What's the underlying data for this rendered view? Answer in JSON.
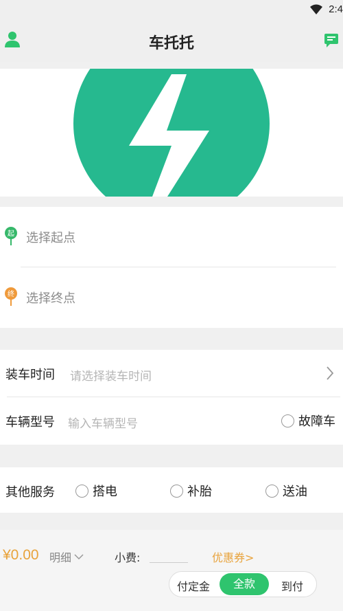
{
  "status_bar": {
    "time": "2:4"
  },
  "header": {
    "title": "车托托"
  },
  "route": {
    "start_placeholder": "选择起点",
    "end_placeholder": "选择终点"
  },
  "loading_time": {
    "label": "装车时间",
    "placeholder": "请选择装车时间"
  },
  "vehicle_model": {
    "label": "车辆型号",
    "placeholder": "输入车辆型号",
    "faulty_label": "故障车"
  },
  "other_services": {
    "label": "其他服务",
    "options": [
      "搭电",
      "补胎",
      "送油"
    ]
  },
  "footer": {
    "price": "¥0.00",
    "detail_label": "明细",
    "tip_label": "小费:",
    "coupon_label": "优惠券>",
    "payment_options": [
      "付定金",
      "全款",
      "到付"
    ],
    "payment_selected": "全款"
  },
  "colors": {
    "accent": "#2fc46e",
    "banner_green": "#26b98f",
    "price": "#e8a33c",
    "start_pin": "#36b86a",
    "end_pin": "#ef9a3b"
  }
}
